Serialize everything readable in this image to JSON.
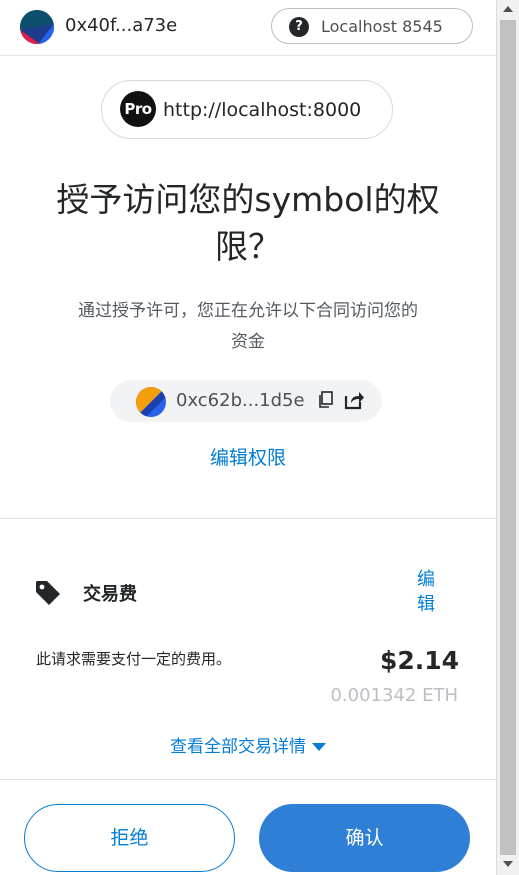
{
  "header": {
    "account_address": "0x40f...a73e",
    "network_label": "Localhost 8545",
    "network_icon": "question-icon"
  },
  "origin": {
    "badge": "Pro",
    "url": "http://localhost:8000"
  },
  "title": {
    "line1": "授予访问您的symbol的权",
    "line2": "限？"
  },
  "description": {
    "line1": "通过授予许可，您正在允许以下合同访问您的",
    "line2": "资金"
  },
  "contract": {
    "address": "0xc62b...1d5e",
    "icons": [
      "copy-icon",
      "share-icon"
    ]
  },
  "edit_permission_link": "编辑权限",
  "fee": {
    "label": "交易费",
    "edit_line1": "编",
    "edit_line2": "辑",
    "note": "此请求需要支付一定的费用。",
    "usd": "$2.14",
    "eth": "0.001342 ETH",
    "details_link": "查看全部交易详情"
  },
  "footer": {
    "reject_label": "拒绝",
    "confirm_label": "确认"
  },
  "colors": {
    "link": "#037dd6",
    "confirm_bg": "#2f7fd6",
    "muted": "#bbc0c5"
  }
}
